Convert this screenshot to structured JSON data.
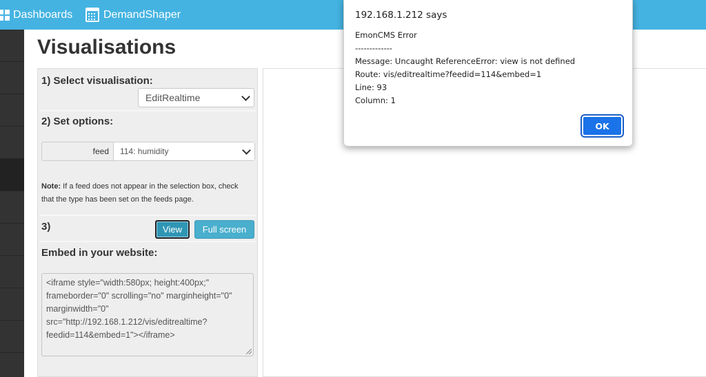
{
  "topnav": {
    "dashboards": "Dashboards",
    "demandshaper": "DemandShaper"
  },
  "page": {
    "title": "Visualisations"
  },
  "panel": {
    "step1_label": "1) Select visualisation:",
    "visualisation_selected": "EditRealtime",
    "step2_label": "2) Set options:",
    "feed_label": "feed",
    "feed_selected": "114: humidity",
    "note_bold": "Note:",
    "note_text": " If a feed does not appear in the selection box, check that the type has been set on the feeds page.",
    "step3_label": "3)",
    "view_button": "View",
    "fullscreen_button": "Full screen",
    "embed_label": "Embed in your website:",
    "embed_code": "<iframe style=\"width:580px; height:400px;\" frameborder=\"0\" scrolling=\"no\" marginheight=\"0\" marginwidth=\"0\" src=\"http://192.168.1.212/vis/editrealtime?feedid=114&embed=1\"></iframe>"
  },
  "dialog": {
    "origin": "192.168.1.212 says",
    "lines": "EmonCMS Error\n-------------\nMessage: Uncaught ReferenceError: view is not defined\nRoute: vis/editrealtime?feedid=114&embed=1\nLine: 93\nColumn: 1",
    "ok": "OK"
  },
  "colors": {
    "topbar": "#44b3e2",
    "sidebar": "#333333",
    "button_primary": "#1a73e8",
    "button_info": "#49afcd"
  },
  "icons": {
    "dashboards": "grid-icon",
    "demandshaper": "calendar-icon",
    "select": "chevron-down-icon"
  }
}
